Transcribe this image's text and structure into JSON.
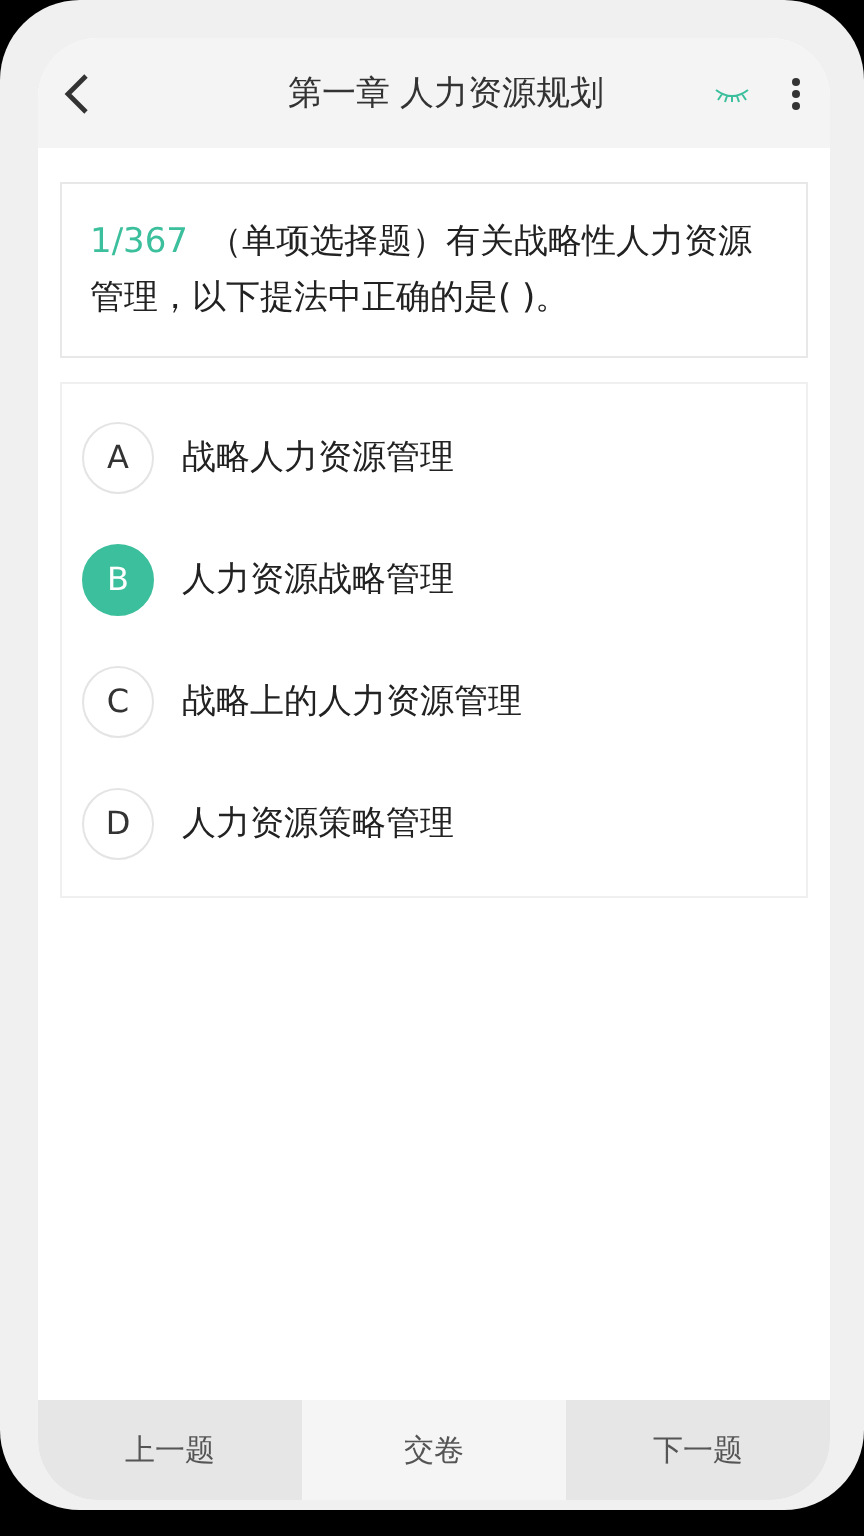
{
  "header": {
    "title": "第一章 人力资源规划"
  },
  "question": {
    "number": "1/367",
    "text": "（单项选择题）有关战略性人力资源管理，以下提法中正确的是( )。"
  },
  "options": [
    {
      "letter": "A",
      "text": "战略人力资源管理",
      "selected": false
    },
    {
      "letter": "B",
      "text": "人力资源战略管理",
      "selected": true
    },
    {
      "letter": "C",
      "text": "战略上的人力资源管理",
      "selected": false
    },
    {
      "letter": "D",
      "text": "人力资源策略管理",
      "selected": false
    }
  ],
  "bottom_bar": [
    {
      "label": "上一题",
      "kind": "nav"
    },
    {
      "label": "交卷",
      "kind": "submit"
    },
    {
      "label": "下一题",
      "kind": "nav"
    }
  ]
}
